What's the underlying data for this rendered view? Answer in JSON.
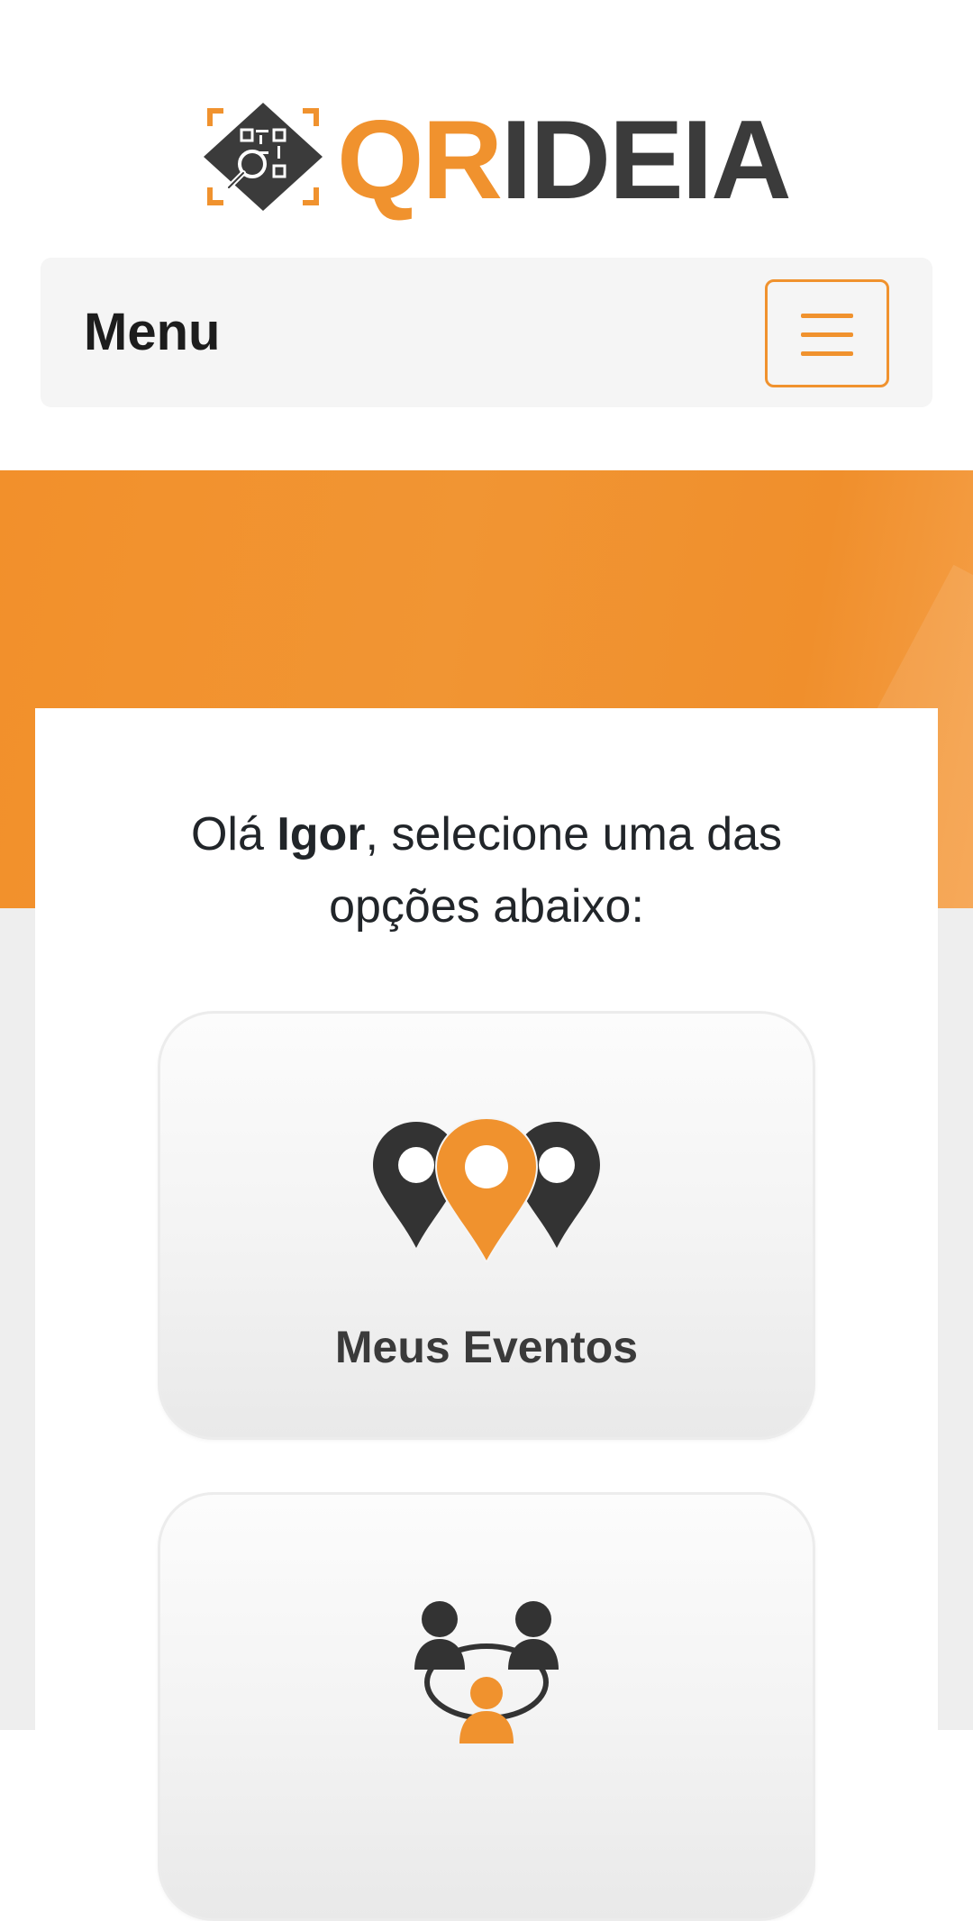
{
  "brand": {
    "logo_part1": "QR",
    "logo_part2": "IDEIA",
    "accent_color": "#f0922e",
    "dark_color": "#3b3b3b"
  },
  "navbar": {
    "brand_label": "Menu",
    "toggler_icon": "hamburger-icon"
  },
  "greeting": {
    "prefix": "Olá ",
    "user_name": "Igor",
    "suffix": ", selecione uma das opções abaixo:"
  },
  "options": [
    {
      "label": "Meus Eventos",
      "icon": "map-pins-icon"
    },
    {
      "label": "",
      "icon": "people-network-icon"
    }
  ]
}
